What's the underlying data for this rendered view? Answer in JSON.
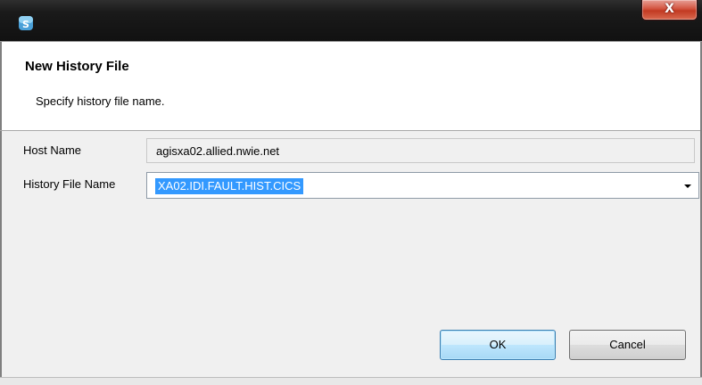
{
  "window": {
    "title": "",
    "close_label": "X"
  },
  "header": {
    "title": "New History File",
    "description": "Specify history file name."
  },
  "form": {
    "host_name_label": "Host Name",
    "host_name_value": "agisxa02.allied.nwie.net",
    "history_file_label": "History File Name",
    "history_file_value": "XA02.IDI.FAULT.HIST.CICS"
  },
  "buttons": {
    "ok_label": "OK",
    "cancel_label": "Cancel"
  },
  "icons": {
    "app": "app-logo-icon",
    "close": "close-icon",
    "dropdown": "chevron-down-icon"
  },
  "colors": {
    "titlebar": "#1a1a1a",
    "close_button": "#c23a22",
    "selection": "#3399ff",
    "dialog_body": "#f0f0f0"
  }
}
